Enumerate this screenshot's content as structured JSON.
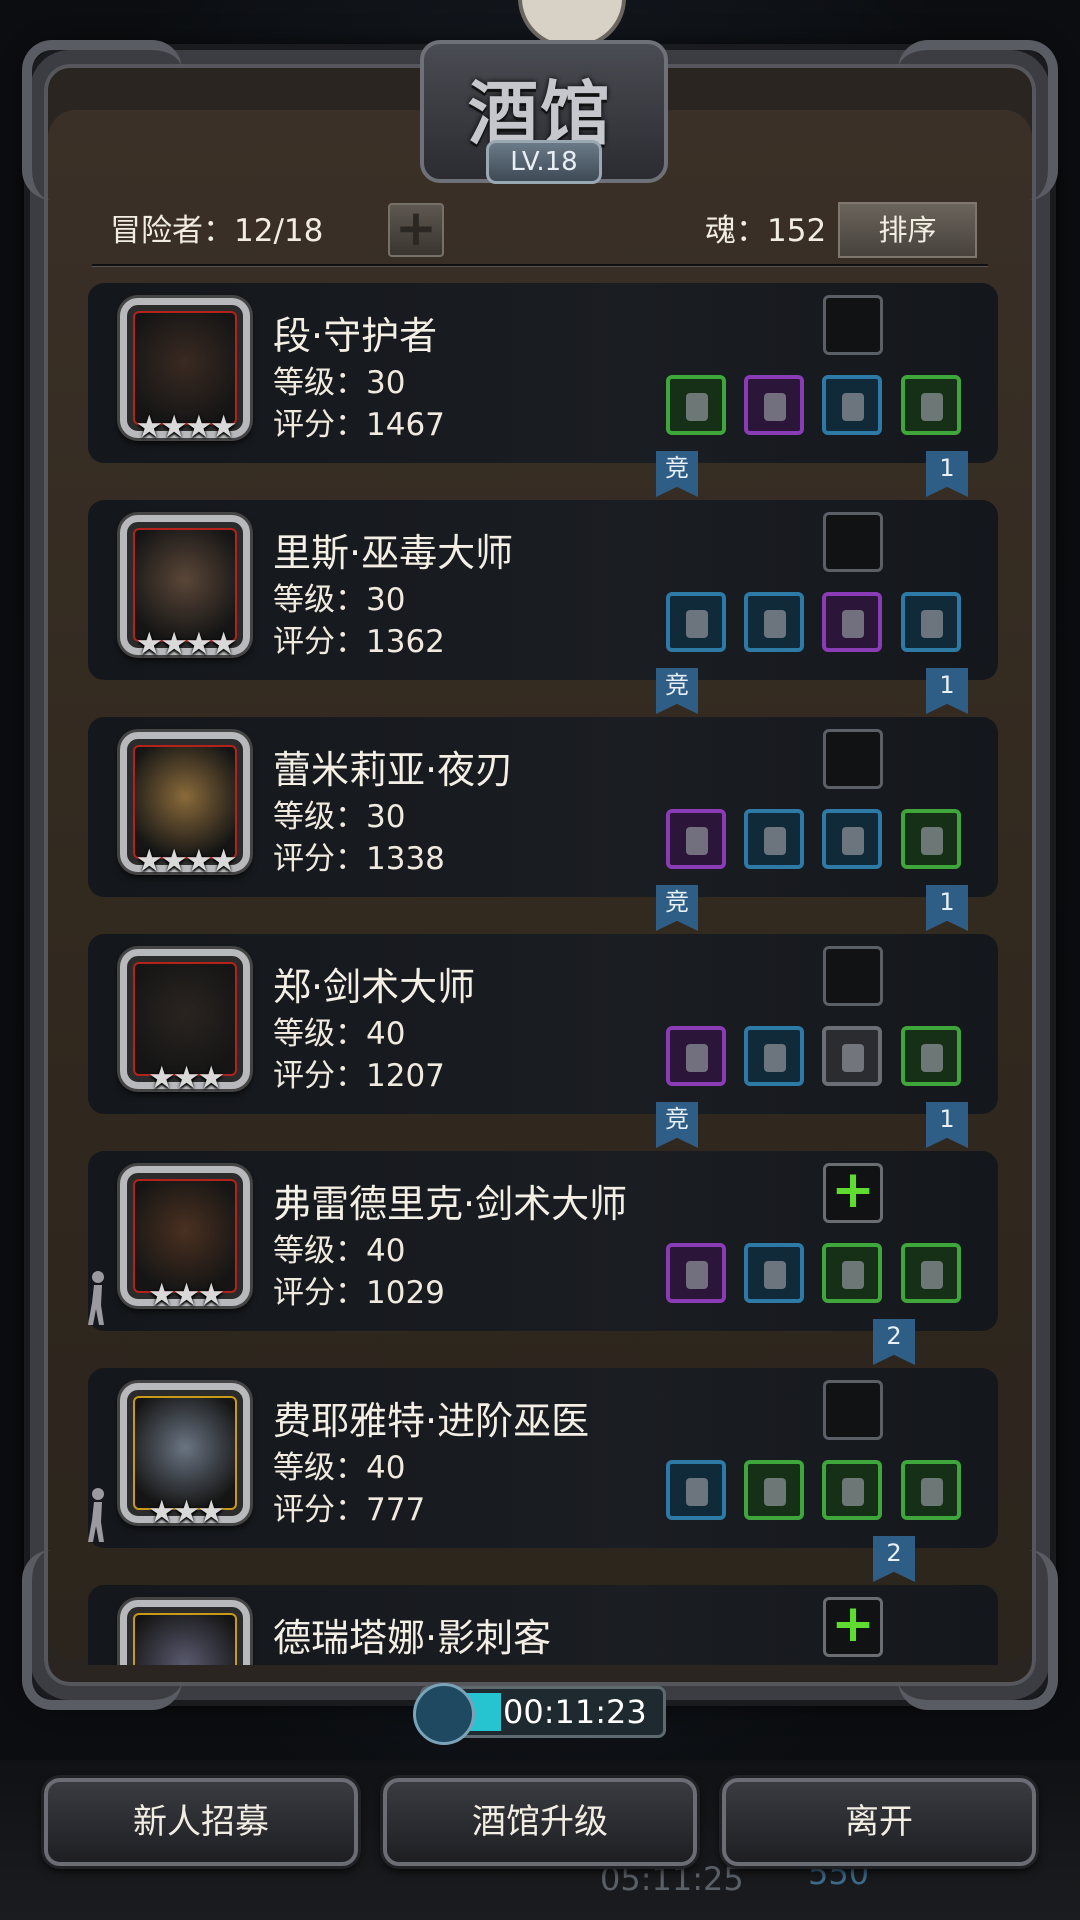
{
  "title": "酒馆",
  "level": "LV.18",
  "header": {
    "adventurers": "冒险者：12/18",
    "soul": "魂：152",
    "sort_label": "排序"
  },
  "flags": {
    "competitive": "竞"
  },
  "heroes": [
    {
      "name": "段·守护者",
      "level": "等级：30",
      "score": "评分：1467",
      "stars": "★★★★",
      "rank": "1",
      "portrait": "red",
      "skill": "purple-crystal-icon",
      "equipment": [
        {
          "q": "green",
          "icon": "greatsword-icon"
        },
        {
          "q": "purple",
          "icon": "red-hood-icon"
        },
        {
          "q": "blue",
          "icon": "claw-gauntlet-icon"
        },
        {
          "q": "green",
          "icon": "ring-icon"
        }
      ]
    },
    {
      "name": "里斯·巫毒大师",
      "level": "等级：30",
      "score": "评分：1362",
      "stars": "★★★★",
      "rank": "1",
      "portrait": "red",
      "skill": "white-claw-icon",
      "equipment": [
        {
          "q": "blue",
          "icon": "staff-icon"
        },
        {
          "q": "blue",
          "icon": "chest-armor-icon"
        },
        {
          "q": "purple",
          "icon": "necklace-icon"
        },
        {
          "q": "blue",
          "icon": "gold-ring-icon"
        }
      ]
    },
    {
      "name": "蕾米莉亚·夜刃",
      "level": "等级：30",
      "score": "评分：1338",
      "stars": "★★★★",
      "rank": "1",
      "portrait": "red",
      "skill": "dark-claw-icon",
      "equipment": [
        {
          "q": "purple",
          "icon": "dagger-icon"
        },
        {
          "q": "blue",
          "icon": "leather-armor-icon"
        },
        {
          "q": "blue",
          "icon": "ring-icon"
        },
        {
          "q": "green",
          "icon": "ring-icon"
        }
      ]
    },
    {
      "name": "郑·剑术大师",
      "level": "等级：40",
      "score": "评分：1207",
      "stars": "★★★",
      "rank": "1",
      "portrait": "red",
      "skill": "red-limb-icon",
      "equipment": [
        {
          "q": "purple",
          "icon": "rapier-icon"
        },
        {
          "q": "blue",
          "icon": "leather-armor-icon"
        },
        {
          "q": "gray",
          "icon": "claw-gauntlet-icon"
        },
        {
          "q": "green",
          "icon": "barrel-armor-icon"
        }
      ]
    },
    {
      "name": "弗雷德里克·剑术大师",
      "level": "等级：40",
      "score": "评分：1029",
      "stars": "★★★",
      "rank": "2",
      "portrait": "red",
      "skill": "add-skill-icon",
      "equipment": [
        {
          "q": "purple",
          "icon": "greatsword-icon"
        },
        {
          "q": "blue",
          "icon": "chest-armor-icon"
        },
        {
          "q": "green",
          "icon": "barrel-armor-icon"
        },
        {
          "q": "green",
          "icon": "amulet-icon"
        }
      ]
    },
    {
      "name": "费耶雅特·进阶巫医",
      "level": "等级：40",
      "score": "评分：777",
      "stars": "★★★",
      "rank": "2",
      "portrait": "gold",
      "skill": "dark-claw-icon",
      "equipment": [
        {
          "q": "blue",
          "icon": "staff-icon"
        },
        {
          "q": "green",
          "icon": "chest-armor-icon"
        },
        {
          "q": "green",
          "icon": "amulet-icon"
        },
        {
          "q": "green",
          "icon": "amulet-icon"
        }
      ]
    },
    {
      "name": "德瑞塔娜·影刺客",
      "level": "",
      "score": "",
      "stars": "",
      "rank": "",
      "portrait": "gold",
      "skill": "add-skill-icon",
      "equipment": []
    }
  ],
  "timer": "00:11:23",
  "buttons": {
    "recruit": "新人招募",
    "upgrade": "酒馆升级",
    "leave": "离开"
  },
  "background_text": {
    "time": "05:11:25",
    "gems": "550"
  },
  "colors": {
    "quality_green": "#3ea63a",
    "quality_blue": "#2d7aa6",
    "quality_purple": "#8a3bb6",
    "timer_fill": "#26c3d0"
  }
}
